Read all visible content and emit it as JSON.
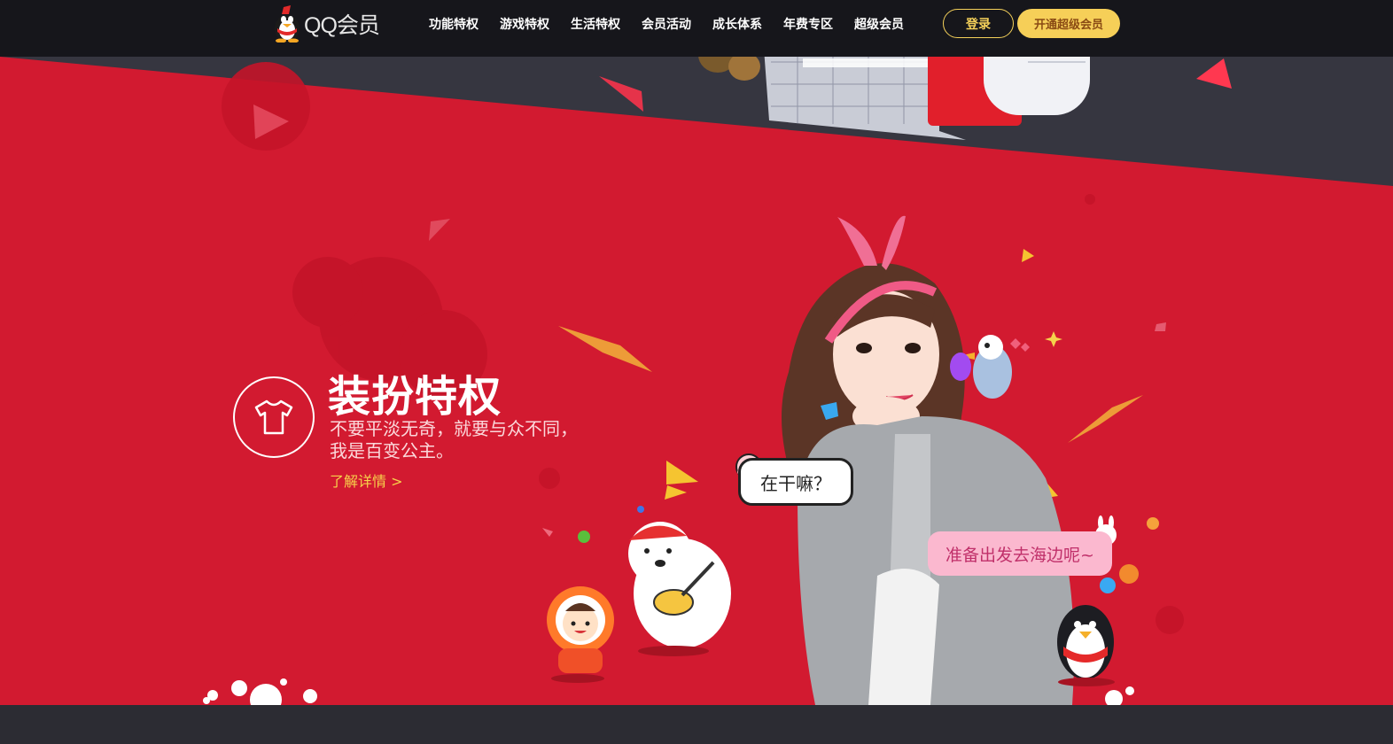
{
  "brand": {
    "logo_text": "QQ会员",
    "icon": "qq-penguin-icon"
  },
  "nav": {
    "items": [
      {
        "label": "功能特权"
      },
      {
        "label": "游戏特权"
      },
      {
        "label": "生活特权"
      },
      {
        "label": "会员活动"
      },
      {
        "label": "成长体系"
      },
      {
        "label": "年费专区"
      },
      {
        "label": "超级会员"
      }
    ],
    "login_label": "登录",
    "open_vip_label": "开通超级会员"
  },
  "feature": {
    "icon": "tshirt-icon",
    "title": "装扮特权",
    "desc_line1": "不要平淡无奇，就要与众不同，",
    "desc_line2": "我是百变公主。",
    "link_label": "了解详情 >"
  },
  "bubbles": {
    "first": "在干嘛？",
    "second": "准备出发去海边呢~"
  },
  "colors": {
    "topbar": "#16161b",
    "hero_red": "#d21a30",
    "dark_band": "#34343e",
    "accent_yellow": "#f6cf58"
  }
}
